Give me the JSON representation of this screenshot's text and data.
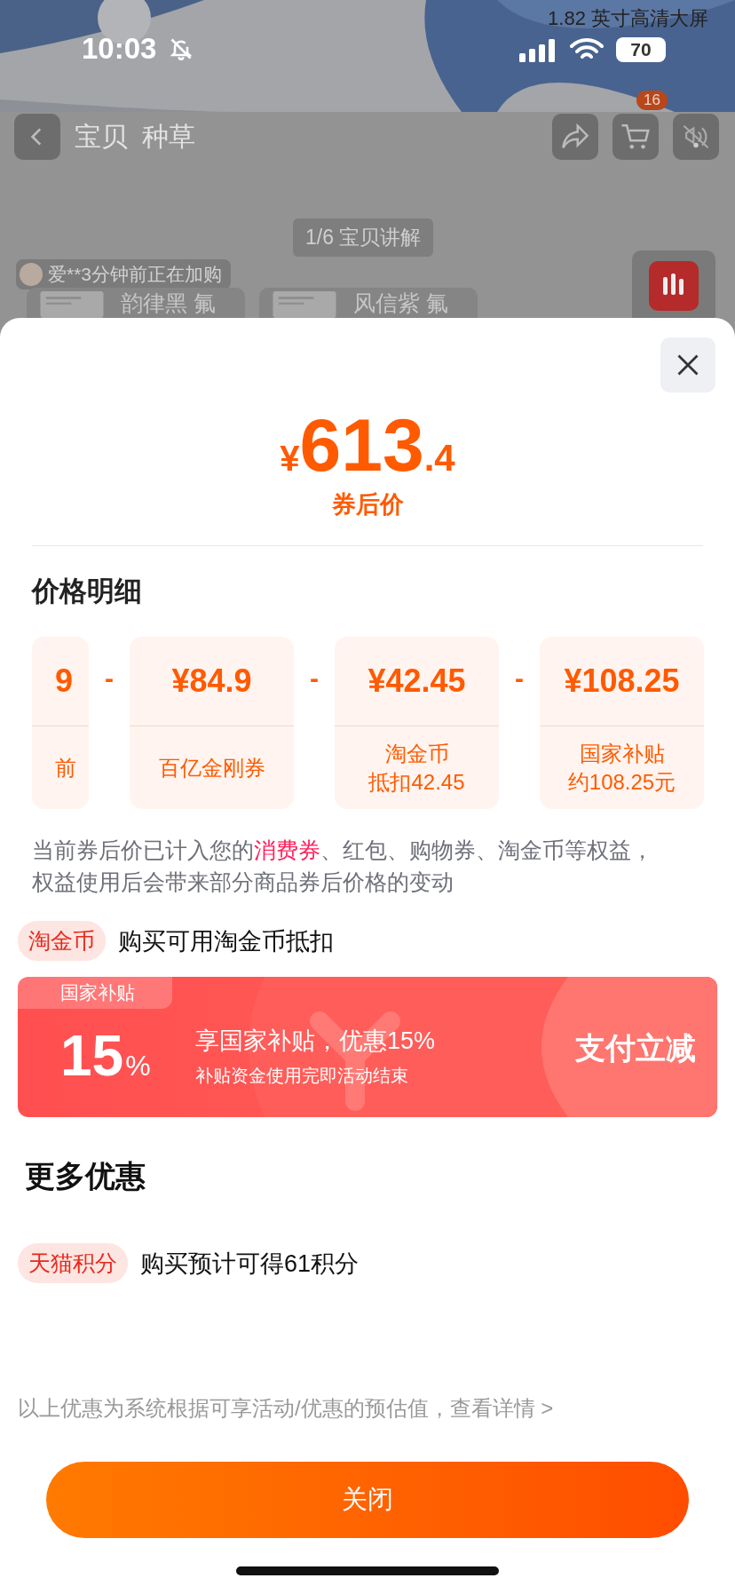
{
  "status_bar": {
    "time": "10:03",
    "battery": "70"
  },
  "banner_caption": "1.82 英寸高清大屏",
  "nav": {
    "tabs": [
      {
        "label": "宝贝",
        "selected": false
      },
      {
        "label": "种草",
        "selected": false
      }
    ],
    "cart_count": "16"
  },
  "live": {
    "explain_pill": "1/6 宝贝讲解",
    "activity": "爱**3分钟前正在加购",
    "products": [
      {
        "label": "韵律黑 氟"
      },
      {
        "label": "风信紫 氟"
      }
    ]
  },
  "sheet": {
    "price": {
      "currency": "¥",
      "integer": "613",
      "decimal": ".4",
      "caption": "券后价"
    },
    "breakdown_title": "价格明细",
    "breakdown": [
      {
        "kind": "cut",
        "amount": "9",
        "label_lines": [
          "前"
        ]
      },
      {
        "kind": "full",
        "operator": "-",
        "amount": "¥84.9",
        "label_lines": [
          "百亿金刚券"
        ]
      },
      {
        "kind": "full",
        "operator": "-",
        "amount": "¥42.45",
        "label_lines": [
          "淘金币",
          "抵扣42.45"
        ]
      },
      {
        "kind": "full",
        "operator": "-",
        "amount": "¥108.25",
        "label_lines": [
          "国家补贴",
          "约108.25元"
        ]
      }
    ],
    "note": [
      {
        "text": "当前券后价已计入您的",
        "highlight": false
      },
      {
        "text": "消费券",
        "highlight": true
      },
      {
        "text": "、红包、购物券、淘金币等权益，权益使用后会带来部分商品券后价格的变动",
        "highlight": false
      }
    ],
    "coin_row": {
      "tag": "淘金币",
      "text": "购买可用淘金币抵扣"
    },
    "subsidy": {
      "tag": "国家补贴",
      "percent": "15",
      "percent_sign": "%",
      "title": "享国家补贴，优惠15%",
      "subtitle": "补贴资金使用完即活动结束",
      "action": "支付立减"
    },
    "more_title": "更多优惠",
    "perks": [
      {
        "tag": "天猫积分",
        "text": "购买预计可得61积分"
      }
    ],
    "footer_note": "以上优惠为系统根据可享活动/优惠的预估值，查看详情 >",
    "close_button": "关闭"
  }
}
